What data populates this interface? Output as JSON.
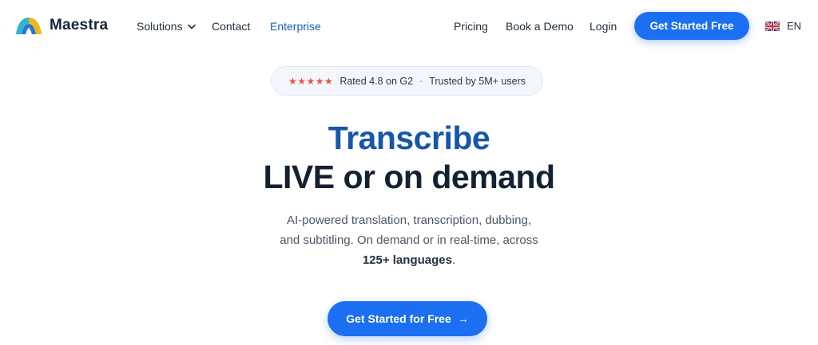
{
  "nav": {
    "brand": "Maestra",
    "links": {
      "solutions": "Solutions",
      "contact": "Contact",
      "enterprise": "Enterprise",
      "pricing": "Pricing",
      "book_demo": "Book a Demo",
      "login": "Login"
    },
    "cta": "Get Started Free",
    "language": "EN"
  },
  "rating": {
    "stars": "★★★★★",
    "rated": "Rated 4.8 on G2",
    "separator": "·",
    "trusted": "Trusted by 5M+ users"
  },
  "hero": {
    "title_line1": "Transcribe",
    "title_line2": "LIVE or on demand",
    "subtitle_line1": "AI-powered translation, transcription, dubbing,",
    "subtitle_line2": "and subtitling. On demand or in real-time, across",
    "subtitle_bold": "125+ languages",
    "subtitle_end": ".",
    "cta": "Get Started for Free",
    "cta_arrow": "→"
  },
  "colors": {
    "primary": "#1c6ff0",
    "title_blue": "#1756a9",
    "title_dark": "#132233",
    "star": "#e8533c"
  }
}
